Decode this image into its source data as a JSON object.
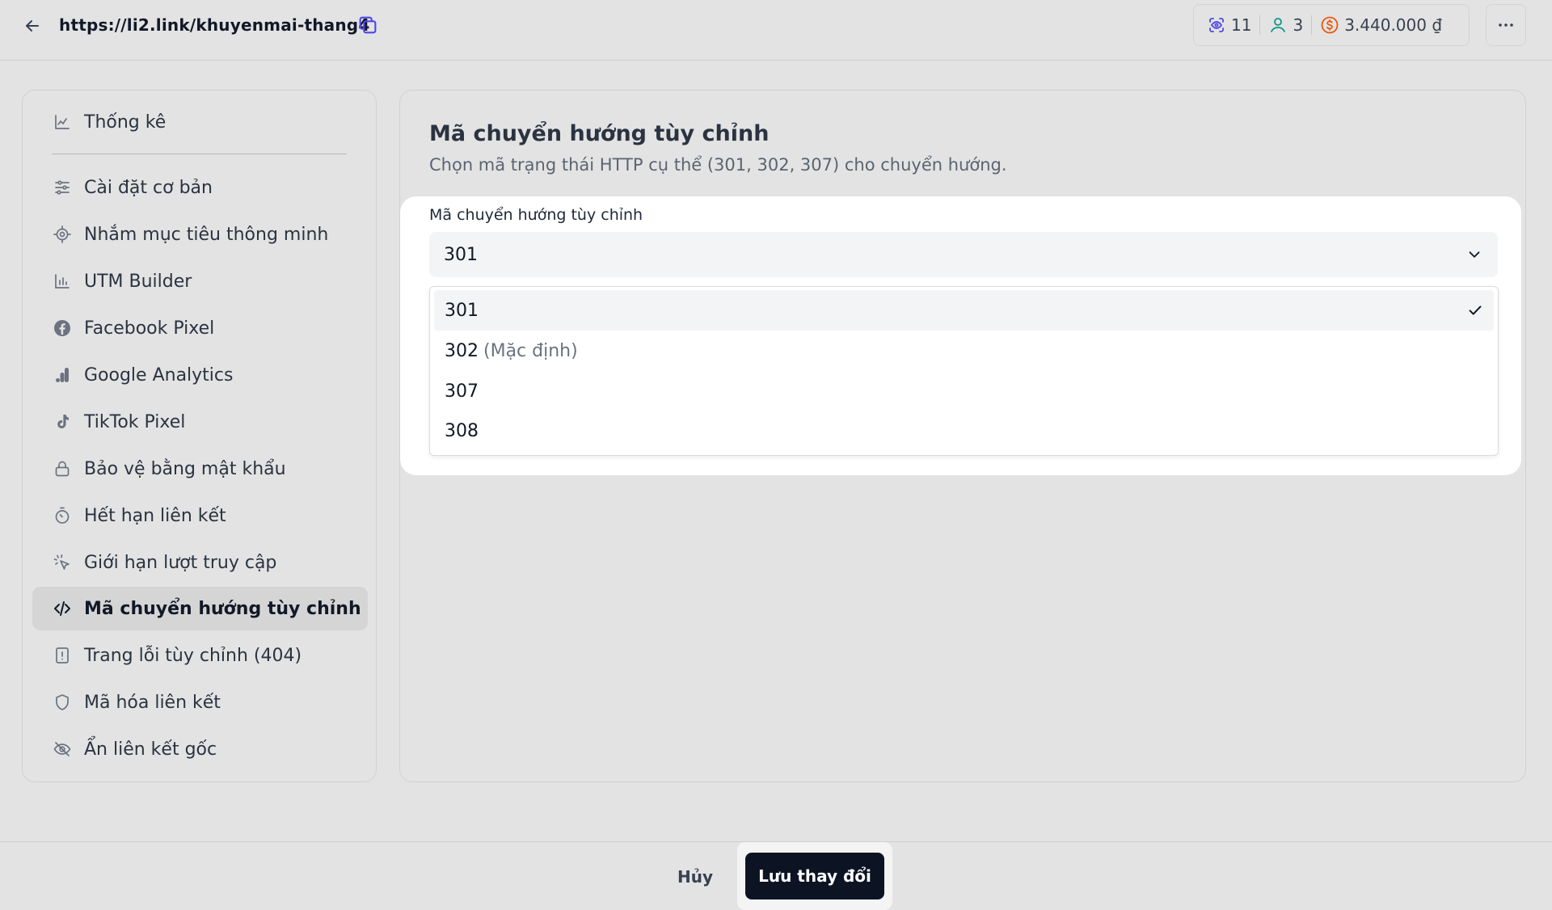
{
  "header": {
    "url": "https://li2.link/khuyenmai-thang4",
    "stats": {
      "views": "11",
      "users": "3",
      "amount": "3.440.000 ₫"
    },
    "colors": {
      "views_icon": "#4f46e5",
      "users_icon": "#0d9488",
      "amount_icon": "#ea580c"
    }
  },
  "sidebar": {
    "items": [
      {
        "label": "Thống kê",
        "icon": "chart-icon"
      },
      {
        "label": "Cài đặt cơ bản",
        "icon": "sliders-icon"
      },
      {
        "label": "Nhắm mục tiêu thông minh",
        "icon": "target-icon"
      },
      {
        "label": "UTM Builder",
        "icon": "bar-chart-icon"
      },
      {
        "label": "Facebook Pixel",
        "icon": "facebook-icon"
      },
      {
        "label": "Google Analytics",
        "icon": "analytics-icon"
      },
      {
        "label": "TikTok Pixel",
        "icon": "tiktok-icon"
      },
      {
        "label": "Bảo vệ bằng mật khẩu",
        "icon": "lock-icon"
      },
      {
        "label": "Hết hạn liên kết",
        "icon": "timer-icon"
      },
      {
        "label": "Giới hạn lượt truy cập",
        "icon": "cursor-click-icon"
      },
      {
        "label": "Mã chuyển hướng tùy chỉnh",
        "icon": "code-icon",
        "active": true
      },
      {
        "label": "Trang lỗi tùy chỉnh (404)",
        "icon": "file-alert-icon"
      },
      {
        "label": "Mã hóa liên kết",
        "icon": "shield-icon"
      },
      {
        "label": "Ẩn liên kết gốc",
        "icon": "eye-off-icon"
      }
    ]
  },
  "main": {
    "title": "Mã chuyển hướng tùy chỉnh",
    "description": "Chọn mã trạng thái HTTP cụ thể (301, 302, 307) cho chuyển hướng.",
    "field_label": "Mã chuyển hướng tùy chỉnh",
    "selected_value": "301",
    "options": [
      {
        "value": "301",
        "hint": "",
        "selected": true
      },
      {
        "value": "302",
        "hint": "(Mặc định)",
        "selected": false
      },
      {
        "value": "307",
        "hint": "",
        "selected": false
      },
      {
        "value": "308",
        "hint": "",
        "selected": false
      }
    ]
  },
  "footer": {
    "cancel_label": "Hủy",
    "save_label": "Lưu thay đổi"
  }
}
